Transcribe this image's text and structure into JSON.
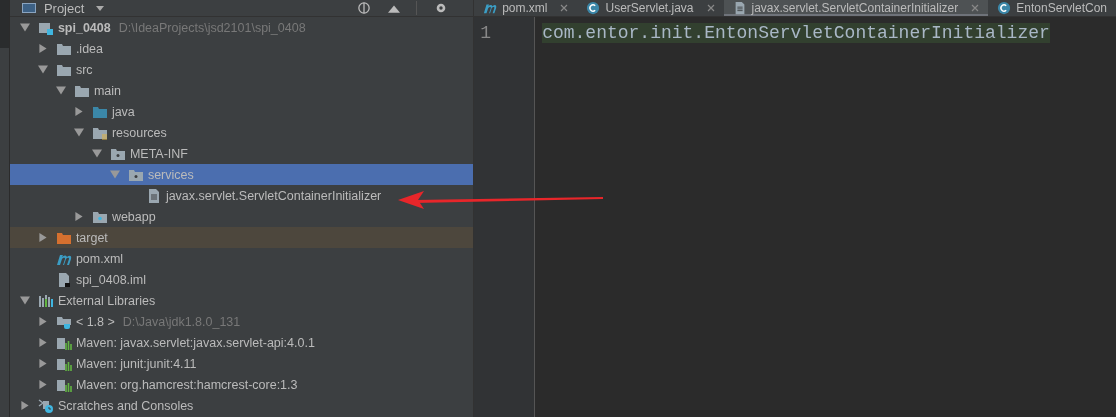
{
  "project_panel": {
    "title": "Project"
  },
  "tree": [
    {
      "label": "spi_0408",
      "path": "D:\\IdeaProjects\\jsd2101\\spi_0408",
      "kind": "module",
      "expanded": true,
      "selected": false,
      "children": [
        {
          "label": ".idea",
          "kind": "folder",
          "expanded": false,
          "selected": false
        },
        {
          "label": "src",
          "kind": "folder",
          "expanded": true,
          "selected": false,
          "children": [
            {
              "label": "main",
              "kind": "folder",
              "expanded": true,
              "selected": false,
              "children": [
                {
                  "label": "java",
                  "kind": "source-folder",
                  "expanded": false,
                  "selected": false
                },
                {
                  "label": "resources",
                  "kind": "resource-folder",
                  "expanded": true,
                  "selected": false,
                  "children": [
                    {
                      "label": "META-INF",
                      "kind": "package",
                      "expanded": true,
                      "selected": false,
                      "children": [
                        {
                          "label": "services",
                          "kind": "package",
                          "expanded": true,
                          "selected": true,
                          "children": [
                            {
                              "label": "javax.servlet.ServletContainerInitializer",
                              "kind": "file",
                              "selected": false
                            }
                          ]
                        }
                      ]
                    }
                  ]
                },
                {
                  "label": "webapp",
                  "kind": "web-folder",
                  "expanded": false,
                  "selected": false
                }
              ]
            }
          ]
        },
        {
          "label": "target",
          "kind": "excluded-folder",
          "expanded": false,
          "selected": false
        },
        {
          "label": "pom.xml",
          "kind": "maven-file",
          "selected": false
        },
        {
          "label": "spi_0408.iml",
          "kind": "iml-file",
          "selected": false
        }
      ]
    },
    {
      "label": "External Libraries",
      "kind": "libraries",
      "expanded": true,
      "selected": false,
      "children": [
        {
          "label": "< 1.8 >",
          "path": "D:\\Java\\jdk1.8.0_131",
          "kind": "jdk",
          "expanded": false,
          "selected": false
        },
        {
          "label": "Maven: javax.servlet:javax.servlet-api:4.0.1",
          "kind": "library",
          "expanded": false,
          "selected": false
        },
        {
          "label": "Maven: junit:junit:4.11",
          "kind": "library",
          "expanded": false,
          "selected": false
        },
        {
          "label": "Maven: org.hamcrest:hamcrest-core:1.3",
          "kind": "library",
          "expanded": false,
          "selected": false
        }
      ]
    },
    {
      "label": "Scratches and Consoles",
      "kind": "scratches",
      "expanded": false,
      "selected": false
    }
  ],
  "editor_tabs": [
    {
      "label": "pom.xml",
      "kind": "maven",
      "selected": false
    },
    {
      "label": "UserServlet.java",
      "kind": "class",
      "selected": false
    },
    {
      "label": "javax.servlet.ServletContainerInitializer",
      "kind": "text",
      "selected": true
    },
    {
      "label": "EntonServletCon",
      "kind": "class",
      "selected": false
    }
  ],
  "editor": {
    "lines": [
      {
        "number": "1",
        "text": "com.entor.init.EntonServletContainerInitializer",
        "highlighted": true
      }
    ]
  }
}
